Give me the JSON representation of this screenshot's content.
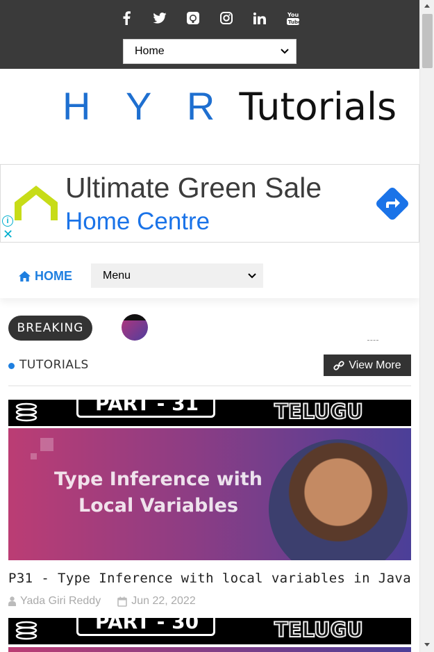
{
  "topbar": {
    "social_icons": [
      "facebook-icon",
      "twitter-icon",
      "github-icon",
      "instagram-icon",
      "linkedin-icon",
      "youtube-icon"
    ],
    "youtube_glyph_text": "You Tube",
    "select_value": "Home"
  },
  "logo": {
    "part1": "H Y R",
    "part2": " Tutorials"
  },
  "ad": {
    "line1": "Ultimate Green Sale",
    "line2": "Home Centre",
    "info_glyph": "i",
    "close_glyph": "✕"
  },
  "nav": {
    "home_label": "HOME",
    "menu_value": "Menu"
  },
  "breaking": {
    "label": "BREAKING"
  },
  "section": {
    "title": "TUTORIALS",
    "view_more": "View More"
  },
  "posts": [
    {
      "banner_part": "PART - 31",
      "banner_lang": "TELUGU",
      "thumb_line1": "Type Inference with",
      "thumb_line2": "Local Variables",
      "title": "P31 - Type Inference with local variables in Java",
      "author": "Yada Giri Reddy",
      "date": "Jun 22, 2022"
    },
    {
      "banner_part": "PART - 30",
      "banner_lang": "TELUGU"
    }
  ],
  "colors": {
    "topbar": "#3a3a3a",
    "accent": "#1e7fe0",
    "dark_button": "#333333",
    "ad_blue": "#1a73e8"
  }
}
